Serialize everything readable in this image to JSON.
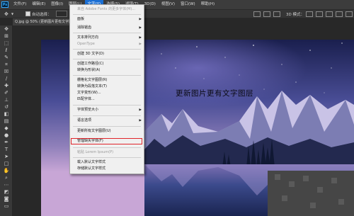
{
  "app": {
    "logo": "Ps"
  },
  "menubar": {
    "items": [
      {
        "label": "文件(F)"
      },
      {
        "label": "编辑(E)"
      },
      {
        "label": "图像(I)"
      },
      {
        "label": "图层(L)"
      },
      {
        "label": "文字(Y)"
      },
      {
        "label": "选择(S)"
      },
      {
        "label": "滤镜(T)"
      },
      {
        "label": "3D(D)"
      },
      {
        "label": "视图(V)"
      },
      {
        "label": "窗口(W)"
      },
      {
        "label": "帮助(H)"
      }
    ]
  },
  "options_bar": {
    "auto_select_label": "自动选择：",
    "right_label": "3D 模式："
  },
  "document": {
    "tab_title": "Q.jpg @ 50% (更新图片更有文字图...",
    "canvas_text": "更新图片更有文字图层"
  },
  "type_menu": {
    "items": [
      {
        "label": "来自 Adobe Fonts 的更多字体(M)...",
        "disabled": true,
        "submenu": false
      },
      {
        "label": "面板",
        "disabled": false,
        "submenu": true
      },
      {
        "label": "消除锯齿",
        "disabled": false,
        "submenu": true
      },
      {
        "label": "文本排列方向",
        "disabled": false,
        "submenu": true
      },
      {
        "label": "OpenType",
        "disabled": true,
        "submenu": true
      },
      {
        "label": "创建 3D 文字(D)",
        "disabled": false,
        "submenu": false
      },
      {
        "label": "创建工作路径(C)",
        "disabled": false,
        "submenu": false
      },
      {
        "label": "转换为形状(A)",
        "disabled": false,
        "submenu": false
      },
      {
        "label": "栅格化文字图层(R)",
        "disabled": false,
        "submenu": false
      },
      {
        "label": "转换为段落文本(T)",
        "disabled": false,
        "submenu": false
      },
      {
        "label": "文字变形(W)...",
        "disabled": false,
        "submenu": false
      },
      {
        "label": "匹配字体...",
        "disabled": false,
        "submenu": false
      },
      {
        "label": "字体预览大小",
        "disabled": false,
        "submenu": true
      },
      {
        "label": "语言选项",
        "disabled": false,
        "submenu": true
      },
      {
        "label": "更新所有文字图层(U)",
        "disabled": false,
        "submenu": false
      },
      {
        "label": "管理缺失字体(F)",
        "disabled": false,
        "submenu": false,
        "highlighted": true
      },
      {
        "label": "粘贴 Lorem Ipsum(P)",
        "disabled": true,
        "submenu": false
      },
      {
        "label": "载入默认文字样式",
        "disabled": false,
        "submenu": false
      },
      {
        "label": "存储默认文字样式",
        "disabled": false,
        "submenu": false
      }
    ],
    "submenu_arrow": "▶"
  },
  "icons": {
    "toolbar": [
      "move-tool-icon",
      "artboard-icon",
      "marquee-tool-icon",
      "lasso-tool-icon",
      "quick-select-icon",
      "crop-tool-icon",
      "frame-tool-icon",
      "eyedropper-icon",
      "healing-brush-icon",
      "brush-tool-icon",
      "clone-stamp-icon",
      "history-brush-icon",
      "eraser-icon",
      "gradient-tool-icon",
      "blur-tool-icon",
      "dodge-tool-icon",
      "pen-tool-icon",
      "type-tool-icon",
      "path-select-icon",
      "rectangle-tool-icon",
      "hand-tool-icon",
      "zoom-tool-icon",
      "more-tools-icon",
      "foreground-color-icon",
      "quick-mask-icon",
      "screen-mode-icon"
    ]
  },
  "colors": {
    "menu_highlight": "#1b6fd4",
    "selection_outline": "#e0242a"
  }
}
